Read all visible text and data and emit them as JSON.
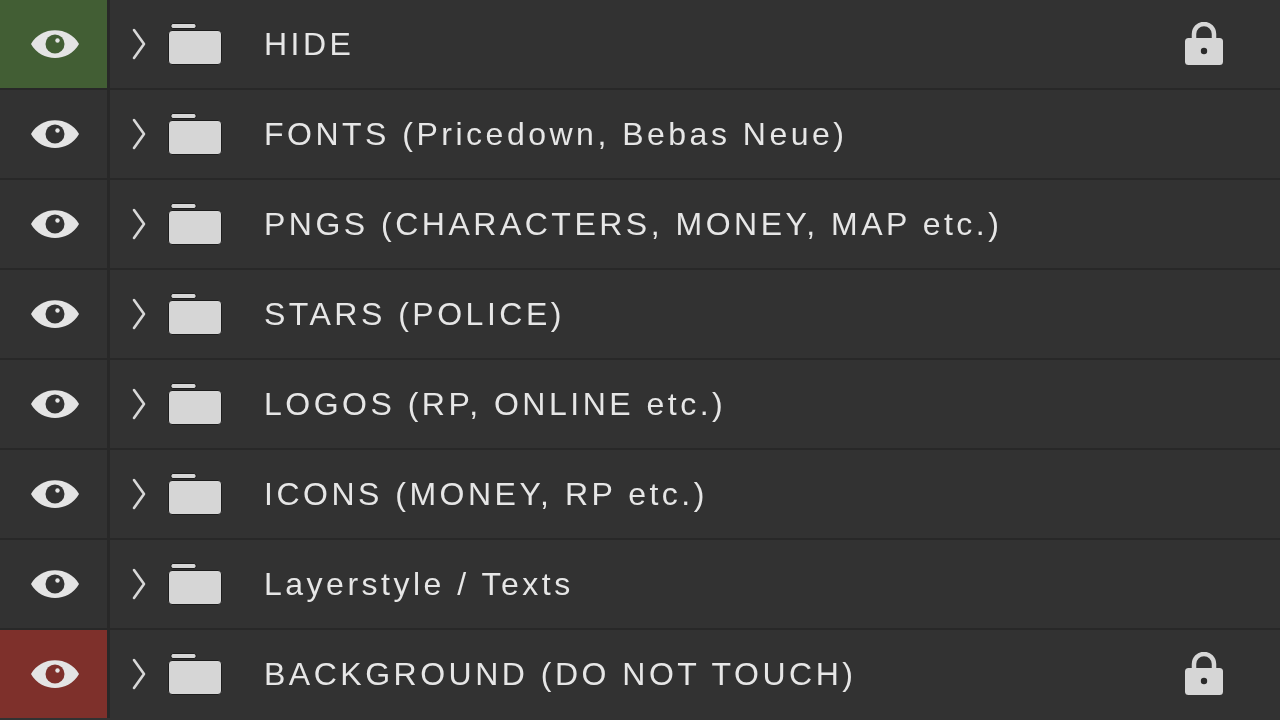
{
  "layers": [
    {
      "name": "HIDE",
      "color": "#425e34",
      "visible": true,
      "expanded": false,
      "locked": true
    },
    {
      "name": "FONTS (Pricedown, Bebas Neue)",
      "visible": true,
      "expanded": false,
      "locked": false
    },
    {
      "name": "PNGS (CHARACTERS, MONEY, MAP etc.)",
      "visible": true,
      "expanded": false,
      "locked": false
    },
    {
      "name": "STARS (POLICE)",
      "visible": true,
      "expanded": false,
      "locked": false
    },
    {
      "name": "LOGOS (RP, ONLINE etc.)",
      "visible": true,
      "expanded": false,
      "locked": false
    },
    {
      "name": "ICONS (MONEY, RP etc.)",
      "visible": true,
      "expanded": false,
      "locked": false
    },
    {
      "name": "Layerstyle / Texts",
      "visible": true,
      "expanded": false,
      "locked": false
    },
    {
      "name": "BACKGROUND (DO NOT TOUCH)",
      "color": "#7e302b",
      "visible": true,
      "expanded": false,
      "locked": true
    }
  ]
}
